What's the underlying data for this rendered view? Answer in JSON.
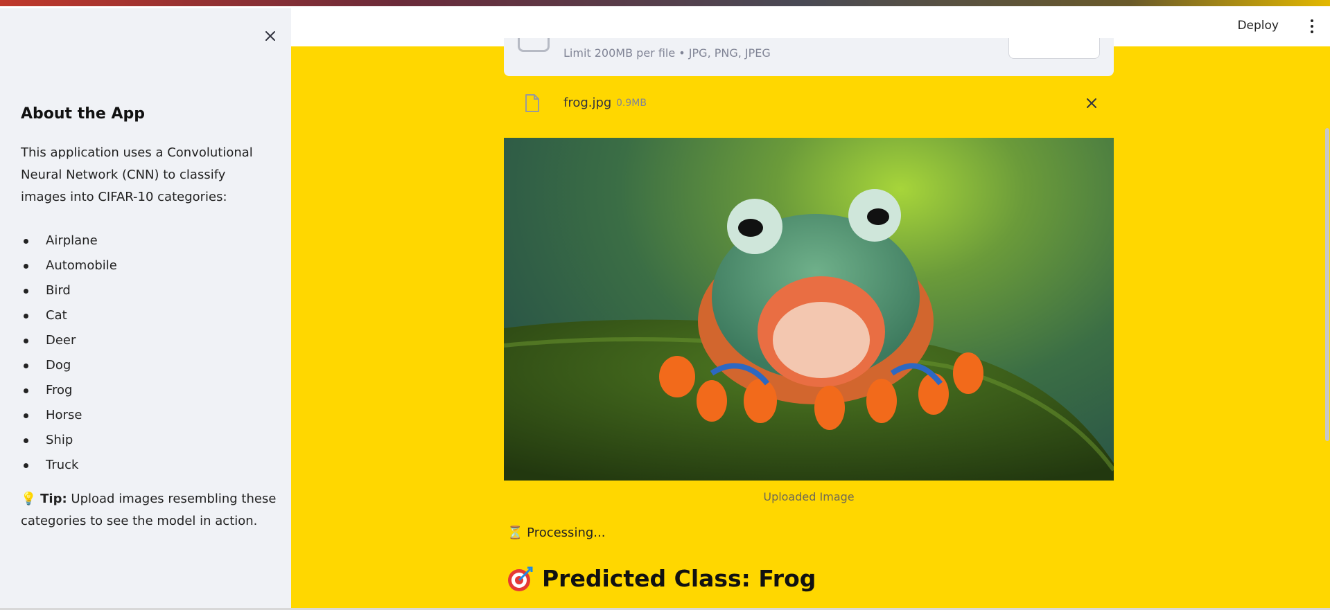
{
  "sidebar": {
    "title": "About the App",
    "intro": "This application uses a Convolutional Neural Network (CNN) to classify images into CIFAR-10 categories:",
    "categories": [
      "Airplane",
      "Automobile",
      "Bird",
      "Cat",
      "Deer",
      "Dog",
      "Frog",
      "Horse",
      "Ship",
      "Truck"
    ],
    "tip_label": "Tip:",
    "tip_text": " Upload images resembling these categories to see the model in action.",
    "tip_icon": "💡"
  },
  "header": {
    "deploy_label": "Deploy"
  },
  "uploader": {
    "limit_text": "Limit 200MB per file • JPG, PNG, JPEG",
    "file_name": "frog.jpg",
    "file_size": "0.9MB"
  },
  "main": {
    "image_caption": "Uploaded Image",
    "processing_icon": "⏳",
    "processing_text": "Processing...",
    "prediction_text": "Predicted Class: Frog"
  },
  "colors": {
    "background": "#ffd700",
    "sidebar": "#f0f2f6"
  }
}
